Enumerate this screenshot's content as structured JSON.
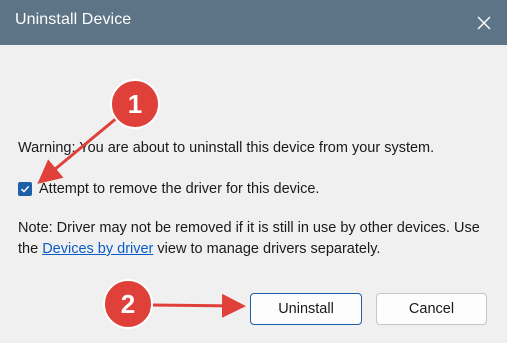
{
  "window": {
    "title": "Uninstall Device",
    "close_icon": "close-icon"
  },
  "body": {
    "warning": "Warning: You are about to uninstall this device from your system.",
    "checkbox": {
      "label": "Attempt to remove the driver for this device.",
      "checked": true
    },
    "note_before": "Note: Driver may not be removed if it is still in use by other devices. Use the ",
    "note_link": "Devices by driver",
    "note_after": " view to manage drivers separately."
  },
  "buttons": {
    "uninstall": "Uninstall",
    "cancel": "Cancel"
  },
  "annotations": {
    "step1": "1",
    "step2": "2",
    "color": "#e0403a"
  },
  "colors": {
    "titlebar": "#5d7386",
    "accent": "#1d5fa8",
    "link": "#0a5cc9"
  }
}
